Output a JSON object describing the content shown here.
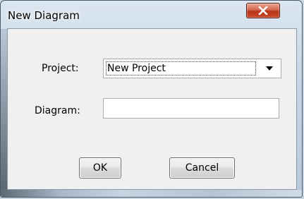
{
  "window": {
    "title": "New Diagram",
    "close_icon": "close-icon"
  },
  "form": {
    "project_label": "Project:",
    "project_value": "New Project",
    "project_dropdown_icon": "chevron-down-icon",
    "diagram_label": "Diagram:",
    "diagram_value": "",
    "diagram_placeholder": ""
  },
  "buttons": {
    "ok_label": "OK",
    "cancel_label": "Cancel"
  },
  "colors": {
    "close_button": "#c8482c",
    "client_background": "#f0f0f0",
    "frame": "#c7d6e4"
  }
}
